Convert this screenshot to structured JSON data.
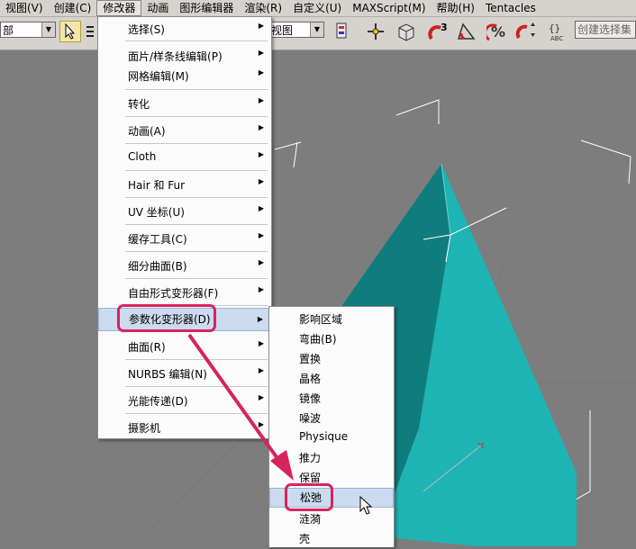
{
  "menubar": {
    "items": [
      "视图(V)",
      "创建(C)",
      "修改器",
      "动画",
      "图形编辑器",
      "渲染(R)",
      "自定义(U)",
      "MAXScript(M)",
      "帮助(H)",
      "Tentacles"
    ]
  },
  "toolbar": {
    "left_combo": "部",
    "view_combo": "视图",
    "selection_set_placeholder": "创建选择集",
    "icons": [
      "select-cursor-icon",
      "text-icon",
      "move-icon",
      "box-icon",
      "snap3-icon",
      "angle-snap-icon",
      "percent-snap-icon",
      "spinner-snap-icon",
      "edit-named-sel-icon"
    ]
  },
  "modifier_menu": {
    "items": [
      {
        "label": "选择(S)",
        "submenu": true
      },
      {
        "label": "面片/样条线编辑(P)",
        "submenu": true
      },
      {
        "label": "网格编辑(M)",
        "submenu": true
      },
      {
        "label": "转化",
        "submenu": true
      },
      {
        "label": "动画(A)",
        "submenu": true
      },
      {
        "label": "Cloth",
        "submenu": true
      },
      {
        "label": "Hair 和 Fur",
        "submenu": true
      },
      {
        "label": "UV 坐标(U)",
        "submenu": true
      },
      {
        "label": "缓存工具(C)",
        "submenu": true
      },
      {
        "label": "细分曲面(B)",
        "submenu": true
      },
      {
        "label": "自由形式变形器(F)",
        "submenu": true
      },
      {
        "label": "参数化变形器(D)",
        "submenu": true
      },
      {
        "label": "曲面(R)",
        "submenu": true
      },
      {
        "label": "NURBS 编辑(N)",
        "submenu": true
      },
      {
        "label": "光能传递(D)",
        "submenu": true
      },
      {
        "label": "摄影机",
        "submenu": true
      }
    ],
    "highlighted": "参数化变形器(D)"
  },
  "param_submenu": {
    "items": [
      "影响区域",
      "弯曲(B)",
      "置换",
      "晶格",
      "镜像",
      "噪波",
      "Physique",
      "推力",
      "保留",
      "松弛",
      "涟漪",
      "壳"
    ],
    "highlighted": "松弛"
  },
  "colors": {
    "menubar_bg": "#d6d3ce",
    "viewport_bg": "#7d7d7d",
    "pyramid_light": "#1eb4b4",
    "pyramid_dark": "#0f7d7d",
    "callout": "#d6245e",
    "menu_highlight": "#ccdbef"
  }
}
